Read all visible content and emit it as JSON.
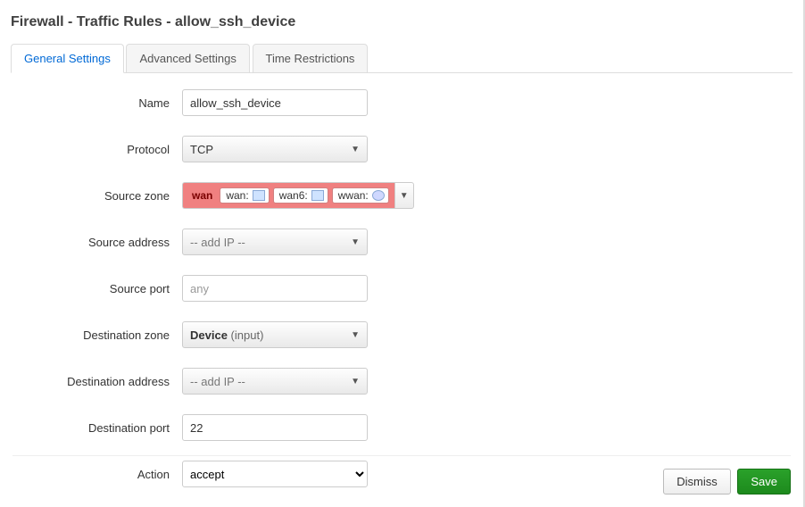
{
  "header": {
    "title": "Firewall - Traffic Rules - allow_ssh_device"
  },
  "tabs": {
    "general": "General Settings",
    "advanced": "Advanced Settings",
    "time": "Time Restrictions"
  },
  "labels": {
    "name": "Name",
    "protocol": "Protocol",
    "source_zone": "Source zone",
    "source_address": "Source address",
    "source_port": "Source port",
    "destination_zone": "Destination zone",
    "destination_address": "Destination address",
    "destination_port": "Destination port",
    "action": "Action"
  },
  "values": {
    "name": "allow_ssh_device",
    "protocol": "TCP",
    "source_address_placeholder": "-- add IP --",
    "source_port_placeholder": "any",
    "destination_zone_device": "Device",
    "destination_zone_sub": "(input)",
    "destination_address_placeholder": "-- add IP --",
    "destination_port": "22",
    "action_selected": "accept"
  },
  "source_zone": {
    "zone": "wan",
    "interfaces": [
      {
        "label": "wan:"
      },
      {
        "label": "wan6:"
      },
      {
        "label": "wwan:"
      }
    ]
  },
  "footer": {
    "dismiss": "Dismiss",
    "save": "Save"
  }
}
